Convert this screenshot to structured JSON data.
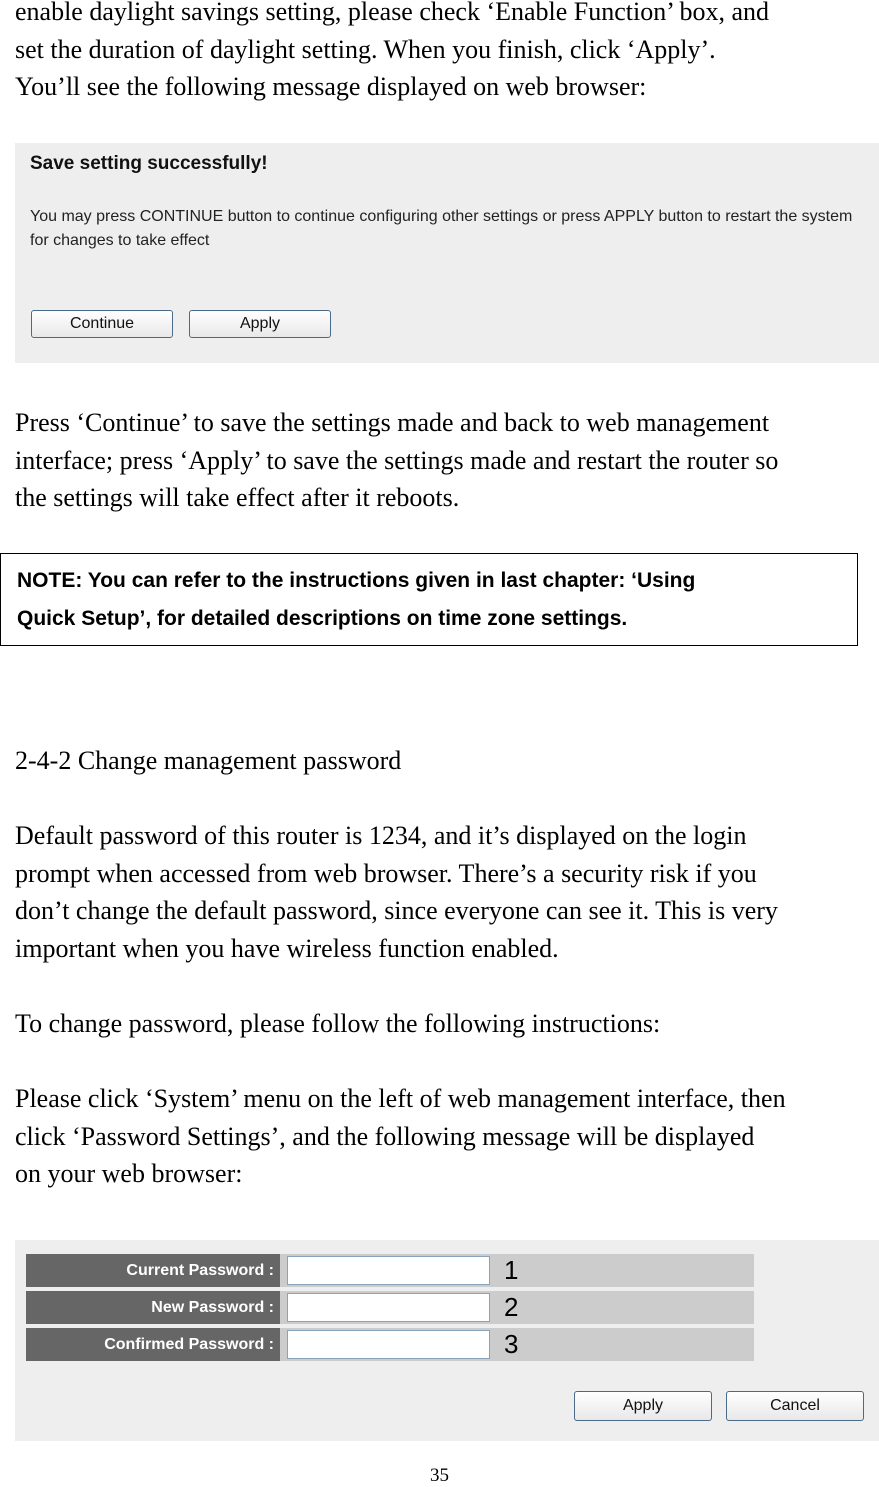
{
  "intro": {
    "lines": [
      "enable daylight savings setting, please check ‘Enable Function’ box, and",
      "set the duration of daylight setting. When you finish, click ‘Apply’.",
      "You’ll see the following message displayed on web browser:"
    ]
  },
  "save_dialog": {
    "title": "Save setting successfully!",
    "message": "You may press CONTINUE button to continue configuring other settings or press APPLY button to restart the system for changes to take effect",
    "continue_label": "Continue",
    "apply_label": "Apply"
  },
  "after_save": {
    "lines": [
      "Press ‘Continue’ to save the settings made and back to web management",
      "interface; press ‘Apply’ to save the settings made and restart the router so",
      "the settings will take effect after it reboots."
    ]
  },
  "note": {
    "lines": [
      "NOTE: You can refer to the instructions given in last chapter: ‘Using",
      "Quick Setup’, for detailed descriptions on time zone settings."
    ]
  },
  "section": {
    "heading": "2-4-2 Change management password",
    "para1": [
      "Default password of this router is 1234, and it’s displayed on the login",
      "prompt when accessed from web browser. There’s a security risk if you",
      "don’t change the default password, since everyone can see it. This is very",
      "important when you have wireless function enabled."
    ],
    "para2": "To change password, please follow the following instructions:",
    "para3": [
      "Please click ‘System’ menu on the left of web management interface, then",
      "click ‘Password Settings’, and the following message will be displayed",
      "on your web browser:"
    ]
  },
  "password_form": {
    "rows": [
      {
        "label": "Current Password :",
        "value": "",
        "marker": "1"
      },
      {
        "label": "New Password :",
        "value": "",
        "marker": "2"
      },
      {
        "label": "Confirmed Password :",
        "value": "",
        "marker": "3"
      }
    ],
    "apply_label": "Apply",
    "cancel_label": "Cancel"
  },
  "page_number": "35"
}
